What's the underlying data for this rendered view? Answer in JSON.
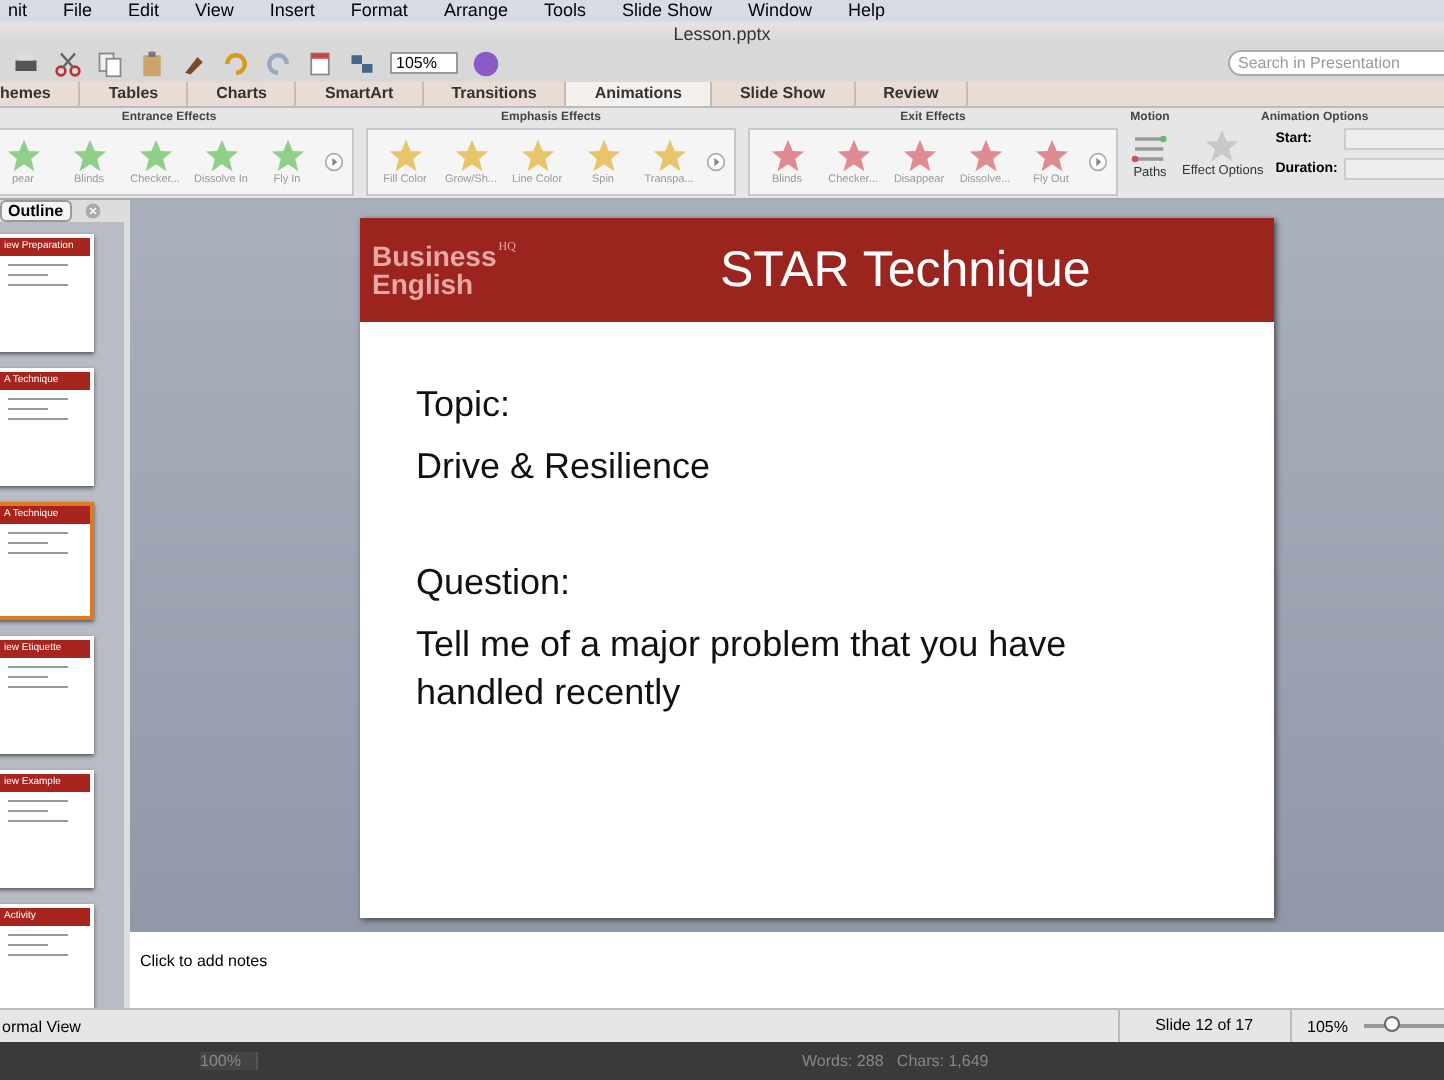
{
  "menu_bar": {
    "items": [
      "nit",
      "File",
      "Edit",
      "View",
      "Insert",
      "Format",
      "Arrange",
      "Tools",
      "Slide Show",
      "Window",
      "Help"
    ]
  },
  "window": {
    "title": "Lesson.pptx"
  },
  "toolbar": {
    "zoom": "105%",
    "search": {
      "placeholder": "Search in Presentation"
    }
  },
  "tabs": [
    {
      "label": "hemes",
      "selected": false
    },
    {
      "label": "Tables",
      "selected": false
    },
    {
      "label": "Charts",
      "selected": false
    },
    {
      "label": "SmartArt",
      "selected": false
    },
    {
      "label": "Transitions",
      "selected": false
    },
    {
      "label": "Animations",
      "selected": true
    },
    {
      "label": "Slide Show",
      "selected": false
    },
    {
      "label": "Review",
      "selected": false
    }
  ],
  "ribbon": {
    "effect_groups": [
      {
        "title": "Entrance Effects",
        "color": "#8fcf8a",
        "items": [
          "pear",
          "Blinds",
          "Checker...",
          "Dissolve In",
          "Fly In"
        ]
      },
      {
        "title": "Emphasis Effects",
        "color": "#e8c46a",
        "items": [
          "Fill Color",
          "Grow/Sh...",
          "Line Color",
          "Spin",
          "Transpa..."
        ]
      },
      {
        "title": "Exit Effects",
        "color": "#e08a92",
        "items": [
          "Blinds",
          "Checker...",
          "Disappear",
          "Dissolve...",
          "Fly Out"
        ]
      }
    ],
    "motion": {
      "title": "Motion",
      "label": "Paths"
    },
    "animation_options": {
      "title": "Animation Options",
      "effect_options": "Effect Options",
      "start_label": "Start:",
      "duration_label": "Duration:"
    }
  },
  "sidebar": {
    "tab": "Outline",
    "thumbnails": [
      {
        "title": "iew Preparation",
        "selected": false
      },
      {
        "title": "A Technique",
        "selected": false
      },
      {
        "title": "A Technique",
        "selected": true
      },
      {
        "title": "iew Etiquette",
        "selected": false
      },
      {
        "title": "iew Example",
        "selected": false
      },
      {
        "title": "Activity",
        "selected": false
      }
    ]
  },
  "slide": {
    "logo": {
      "line_1": "Business",
      "line_2": "English",
      "mark": "HQ"
    },
    "title": "STAR Technique",
    "body": [
      {
        "kind": "label",
        "text": "Topic:"
      },
      {
        "kind": "text",
        "text": "Drive & Resilience"
      },
      {
        "kind": "label",
        "text": "Question:"
      },
      {
        "kind": "text",
        "text": "Tell me of a major problem that you have handled recently"
      }
    ]
  },
  "notes": {
    "placeholder": "Click to add notes"
  },
  "status_bar": {
    "view": "ormal View",
    "slide": "Slide 12 of 17",
    "zoom": "105%",
    "level": 0.3
  },
  "bottom_bar": {
    "zoom": "100%",
    "counts": "Words: 288   Chars: 1,649"
  }
}
